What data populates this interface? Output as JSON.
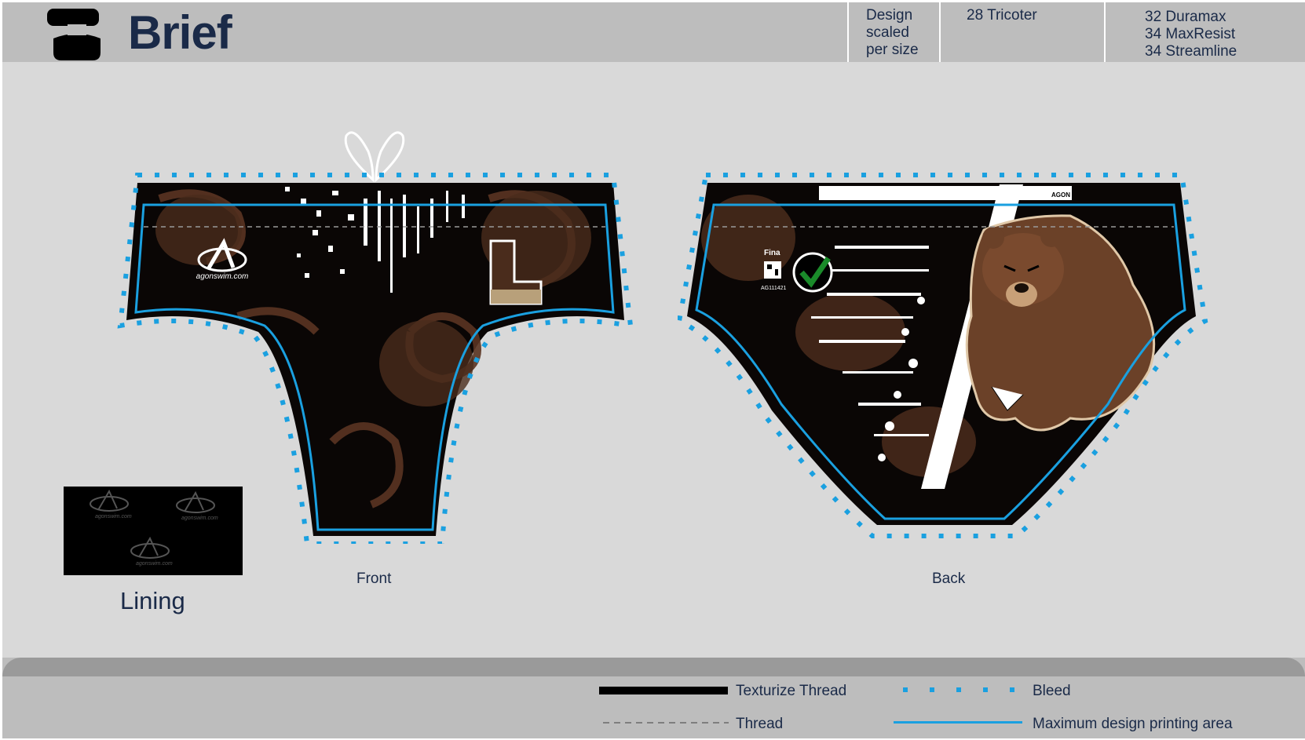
{
  "header": {
    "title": "Brief",
    "design_note": [
      "Design",
      "scaled",
      "per size"
    ],
    "fabric_note": "28 Tricoter",
    "sizes": [
      "32 Duramax",
      "34 MaxResist",
      "34 Streamline"
    ]
  },
  "views": {
    "front_label": "Front",
    "back_label": "Back"
  },
  "lining": {
    "label": "Lining",
    "logo_text": "agonswim.com"
  },
  "front_logo_text": "agonswim.com",
  "front_badge_letter": "L",
  "back_tag": {
    "brand": "AGON",
    "fina_label": "Fina",
    "code": "AG111421"
  },
  "legend": {
    "texturize_thread": "Texturize Thread",
    "bleed": "Bleed",
    "thread": "Thread",
    "max_area": "Maximum design printing area"
  },
  "colors": {
    "navy": "#1a2a48",
    "bleed_blue": "#1aa0e0",
    "brown": "#4a2c1c",
    "tan": "#b8a07a",
    "check_green": "#1a8a2a"
  }
}
